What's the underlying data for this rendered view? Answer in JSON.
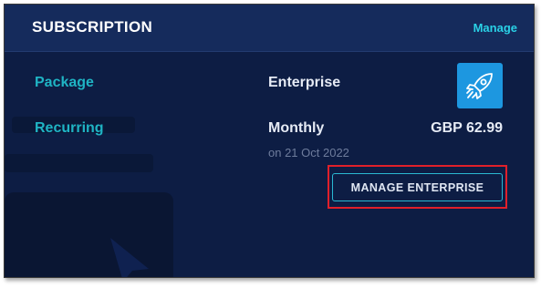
{
  "header": {
    "title": "SUBSCRIPTION",
    "manage_link": "Manage"
  },
  "details": {
    "package_label": "Package",
    "package_value": "Enterprise",
    "recurring_label": "Recurring",
    "recurring_value": "Monthly",
    "date_text": "on 21 Oct 2022",
    "price": "GBP 62.99"
  },
  "plan_icon": "rocket-icon",
  "action": {
    "button_label": "MANAGE ENTERPRISE"
  },
  "colors": {
    "card_bg": "#0d1d44",
    "header_bg": "#152b5c",
    "accent": "#1fb4c4",
    "link": "#2ad1e6",
    "icon_bg": "#1d97e0",
    "highlight": "#e0202a"
  }
}
